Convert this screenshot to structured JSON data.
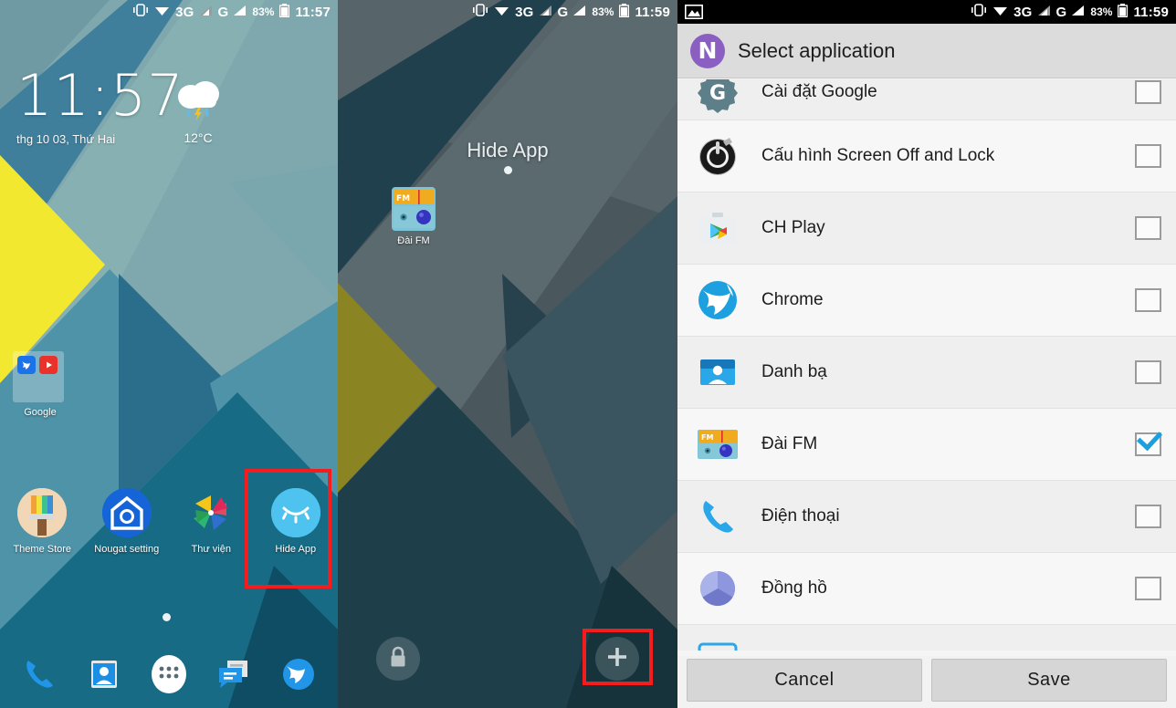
{
  "panel1": {
    "statusbar": {
      "icons": [
        "vibrate-icon",
        "wifi-icon",
        "3g-icon",
        "signal-icon",
        "g-icon",
        "signal2-icon"
      ],
      "battery_pct": "83%",
      "time": "11:57"
    },
    "clock": {
      "time": "11:57",
      "date": "thg 10 03, Thứ Hai"
    },
    "weather": {
      "icon": "thunder-cloud-icon",
      "temp": "12°C"
    },
    "folder": {
      "label": "Google",
      "icons": [
        "chrome-icon",
        "youtube-icon"
      ]
    },
    "apps": [
      {
        "label": "Theme Store",
        "icon": "paintbrush-icon"
      },
      {
        "label": "Nougat setting",
        "icon": "home-gear-icon"
      },
      {
        "label": "Thư viện",
        "icon": "photos-pinwheel-icon"
      },
      {
        "label": "Hide App",
        "icon": "closed-eye-icon",
        "highlighted": true
      }
    ],
    "dock": [
      "phone-icon",
      "contacts-icon",
      "all-apps-icon",
      "messages-icon",
      "browser-icon"
    ]
  },
  "panel2": {
    "statusbar": {
      "battery_pct": "83%",
      "time": "11:59"
    },
    "title": "Hide App",
    "apps": [
      {
        "label": "Đài FM",
        "icon": "fm-radio-icon"
      }
    ],
    "lock_button": "lock-icon",
    "add_button": "plus-icon"
  },
  "panel3": {
    "statusbar": {
      "left_icon": "image-icon",
      "battery_pct": "83%",
      "time": "11:59"
    },
    "dialog": {
      "logo": "nova-n-icon",
      "title": "Select application",
      "apps": [
        {
          "name": "Cài đặt Google",
          "icon": "google-settings-icon",
          "checked": false
        },
        {
          "name": "Cấu hình Screen Off and Lock",
          "icon": "screen-off-lock-icon",
          "checked": false
        },
        {
          "name": "CH Play",
          "icon": "play-store-icon",
          "checked": false
        },
        {
          "name": "Chrome",
          "icon": "chrome-globe-icon",
          "checked": false
        },
        {
          "name": "Danh bạ",
          "icon": "contacts-icon",
          "checked": false
        },
        {
          "name": "Đài FM",
          "icon": "fm-radio-icon",
          "checked": true
        },
        {
          "name": "Điện thoại",
          "icon": "phone-icon",
          "checked": false
        },
        {
          "name": "Đồng hồ",
          "icon": "clock-icon",
          "checked": false
        }
      ],
      "cancel_label": "Cancel",
      "save_label": "Save"
    }
  },
  "colors": {
    "accent_blue": "#1a9fe0",
    "highlight_red": "#f41c1c",
    "nova_purple": "#8a5fc1",
    "wall_teal": "#79a6ad",
    "wall_dark": "#2a4047"
  }
}
